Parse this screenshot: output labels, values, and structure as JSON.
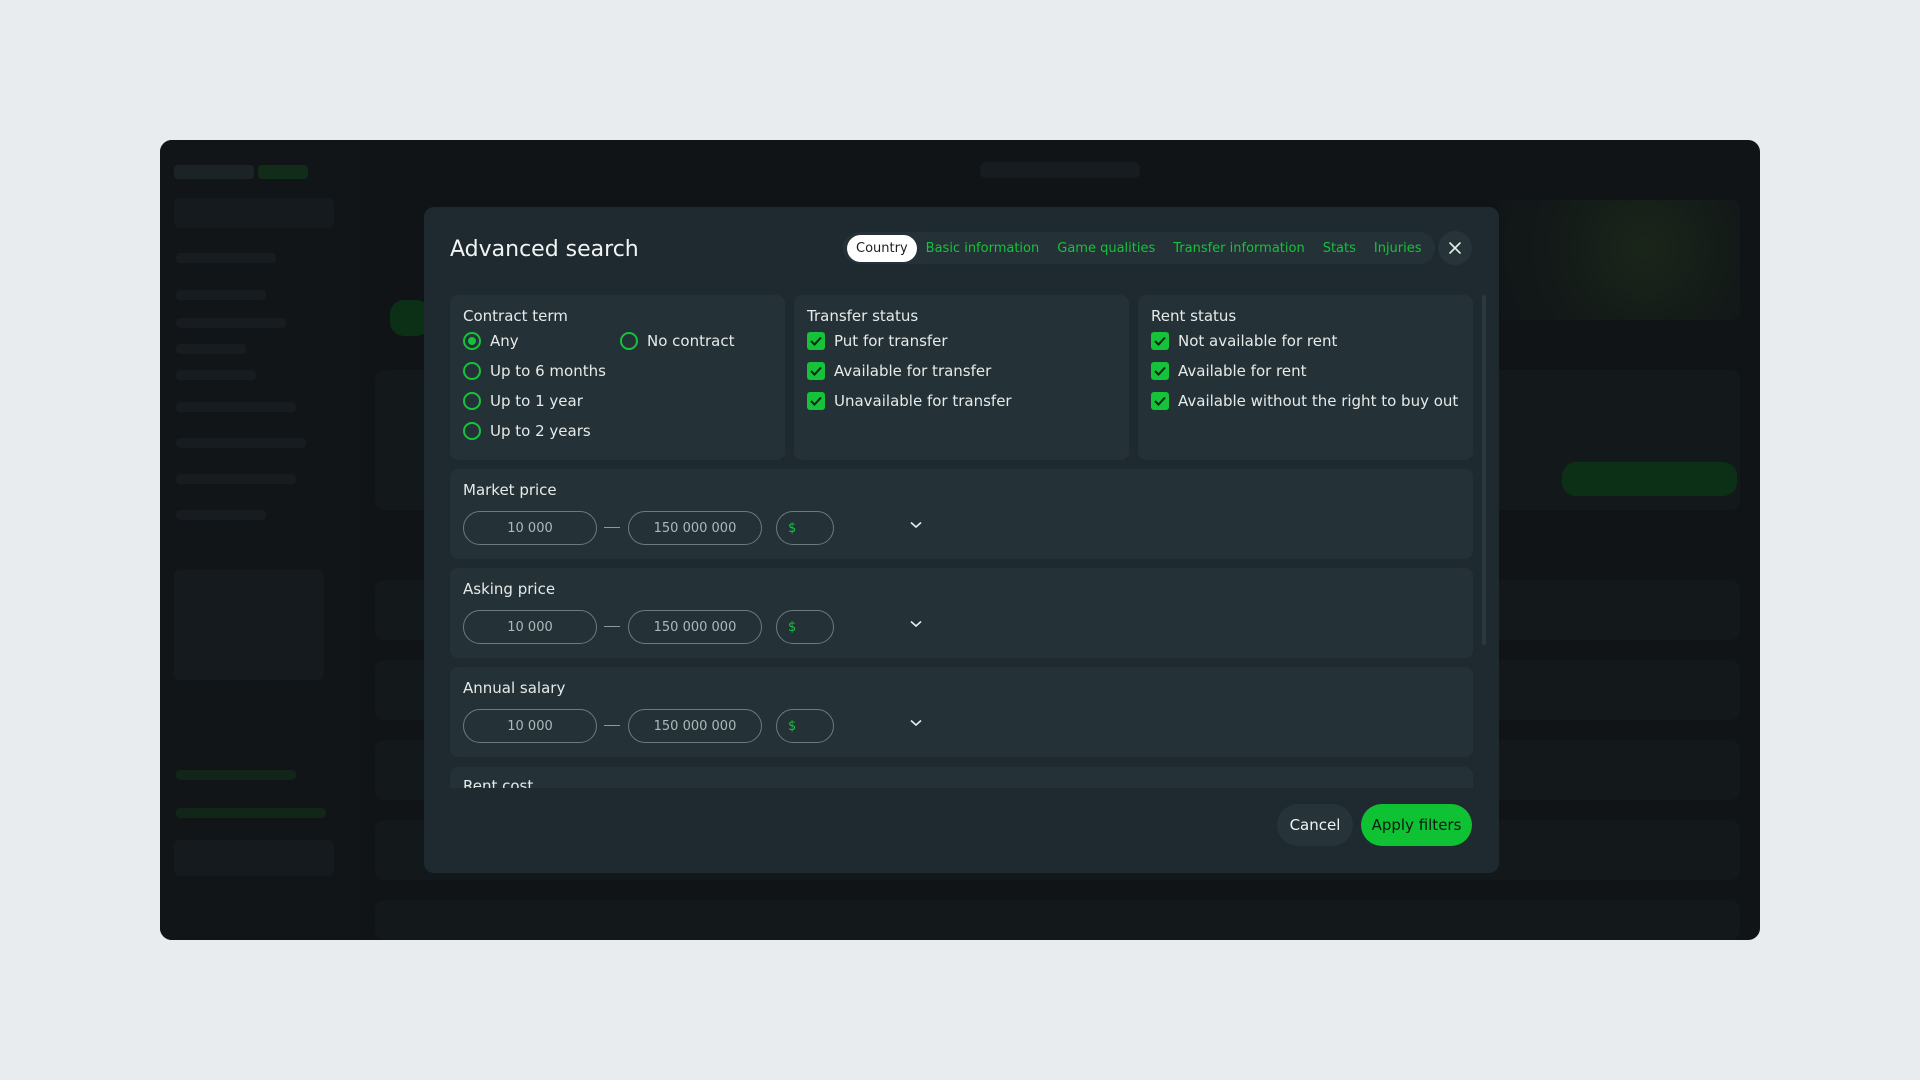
{
  "modal": {
    "title": "Advanced search",
    "tabs": [
      {
        "label": "Country",
        "active": true
      },
      {
        "label": "Basic information",
        "active": false
      },
      {
        "label": "Game qualities",
        "active": false
      },
      {
        "label": "Transfer information",
        "active": false
      },
      {
        "label": "Stats",
        "active": false
      },
      {
        "label": "Injuries",
        "active": false
      }
    ],
    "close_icon": "close-icon"
  },
  "contract_term": {
    "heading": "Contract term",
    "selected": "Any",
    "options": [
      "Any",
      "No contract",
      "Up to 6 months",
      "Up to 1 year",
      "Up to 2 years"
    ]
  },
  "transfer_status": {
    "heading": "Transfer status",
    "options": [
      {
        "label": "Put for transfer",
        "checked": true
      },
      {
        "label": "Available for transfer",
        "checked": true
      },
      {
        "label": "Unavailable for transfer",
        "checked": true
      }
    ]
  },
  "rent_status": {
    "heading": "Rent status",
    "options": [
      {
        "label": "Not available for rent",
        "checked": true
      },
      {
        "label": "Available for rent",
        "checked": true
      },
      {
        "label": "Available without the right to buy out",
        "checked": true
      }
    ]
  },
  "market_price": {
    "heading": "Market price",
    "from_placeholder": "10 000",
    "to_placeholder": "150 000 000",
    "currency": "$"
  },
  "asking_price": {
    "heading": "Asking price",
    "from_placeholder": "10 000",
    "to_placeholder": "150 000 000",
    "currency": "$"
  },
  "annual_salary": {
    "heading": "Annual salary",
    "from_placeholder": "10 000",
    "to_placeholder": "150 000 000",
    "currency": "$"
  },
  "rent_cost": {
    "heading": "Rent cost"
  },
  "footer": {
    "cancel_label": "Cancel",
    "apply_label": "Apply filters"
  },
  "colors": {
    "accent": "#0fc233",
    "modal_bg": "#1e2a30",
    "card_bg": "#243137",
    "page_bg": "#e8ecef"
  }
}
